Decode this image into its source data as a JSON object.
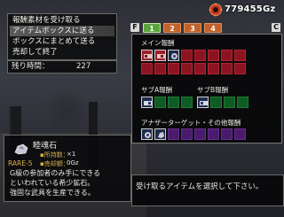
{
  "menu": {
    "items": [
      {
        "label": "報酬素材を受け取る",
        "selected": false
      },
      {
        "label": "アイテムボックスに送る",
        "selected": true
      },
      {
        "label": "ボックスにまとめて送る",
        "selected": false
      },
      {
        "label": "売却して終了",
        "selected": false
      }
    ]
  },
  "timer": {
    "label": "残り時間：",
    "value": "227"
  },
  "zenny": {
    "amount": "779455Gz",
    "icon": "zenny-coin-icon"
  },
  "tabs": {
    "key_left": "F",
    "key_right": "C",
    "items": [
      {
        "label": "1",
        "active": true
      },
      {
        "label": "2",
        "active": false
      },
      {
        "label": "3",
        "active": false
      },
      {
        "label": "4",
        "active": false
      }
    ]
  },
  "rewards": {
    "main_label": "メイン報酬",
    "sub_a_label": "サブA報酬",
    "sub_b_label": "サブB報酬",
    "another_label": "アナザーターゲット・その他報酬",
    "colors": {
      "main": "#8c1420",
      "sub": "#0e5c24",
      "other": "#4a1a6c"
    }
  },
  "item": {
    "name": "睦魂石",
    "rarity": "RARE-5",
    "qty_label": "▪所持数：",
    "qty_value": "×1",
    "price_label": "▪売却額：",
    "price_value": "0Gz",
    "description": [
      "G級の参加者のみ手にできる",
      "といわれている希少鉱石。",
      "強固な武具を生産できる。"
    ]
  },
  "message": {
    "text": "受け取るアイテムを選択して下さい。"
  }
}
